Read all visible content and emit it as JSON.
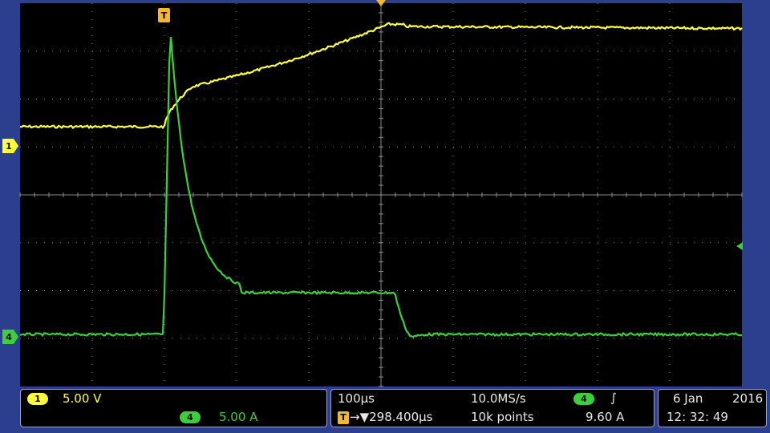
{
  "colors": {
    "ch1": "#ffff3c",
    "ch4": "#3ccf3c",
    "grid": "#9a9a9a",
    "screen_bg": "#000000",
    "frame": "#2b3f8e",
    "trigger_marker": "#f5b630"
  },
  "markers": {
    "trigger_top": "T",
    "ch1_level": "1",
    "ch4_level": "4"
  },
  "channel1": {
    "badge": "1",
    "scale": "5.00 V"
  },
  "channel4": {
    "badge": "4",
    "scale": "5.00 A"
  },
  "horizontal": {
    "time_per_div": "100µs",
    "sample_rate": "10.0MS/s",
    "trigger_badge": "T",
    "trigger_position": "→▼298.400µs",
    "record_length": "10k points"
  },
  "trigger": {
    "source_badge": "4",
    "slope_icon": "rising-edge-icon",
    "slope_glyph": "∫",
    "level": "9.60 A"
  },
  "datetime": {
    "date_day_month": "6 Jan",
    "year": "2016",
    "time": "12: 32: 49"
  }
}
